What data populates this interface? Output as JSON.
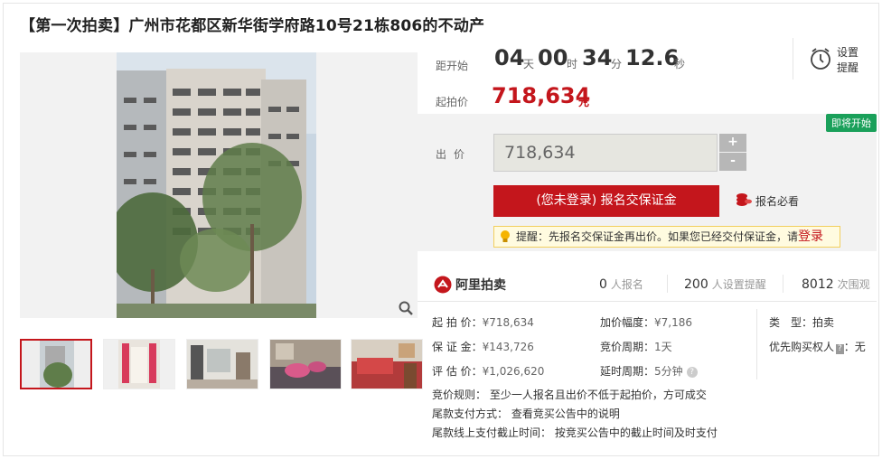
{
  "title": "【第一次拍卖】广州市花都区新华街学府路10号21栋806的不动产",
  "countdown": {
    "label": "距开始",
    "days": "04",
    "days_unit": "天",
    "hours": "00",
    "hours_unit": "时",
    "minutes": "34",
    "minutes_unit": "分",
    "seconds": "12.6",
    "seconds_unit": "秒"
  },
  "remind": {
    "line1": "设置",
    "line2": "提醒",
    "icon": "alarm-clock-icon"
  },
  "start_price": {
    "label": "起拍价",
    "value": "718,634",
    "unit": "元"
  },
  "badge": "即将开始",
  "bid": {
    "label": "出价",
    "value": "718,634",
    "plus": "+",
    "minus": "-",
    "signup_button": "(您未登录) 报名交保证金",
    "must_read": "报名必看",
    "notice_text": "提醒：先报名交保证金再出价。如果您已经交付保证金，请",
    "notice_link": "登录"
  },
  "stats": {
    "logo": "阿里拍卖",
    "signups": "0",
    "signups_unit": "人报名",
    "reminders": "200",
    "reminders_unit": "人设置提醒",
    "views": "8012",
    "views_unit": "次围观"
  },
  "details": {
    "start_price_k": "起 拍 价：",
    "start_price_v": "¥718,634",
    "deposit_k": "保 证 金：",
    "deposit_v": "¥143,726",
    "appraisal_k": "评 估 价：",
    "appraisal_v": "¥1,026,620",
    "increment_k": "加价幅度：",
    "increment_v": "¥7,186",
    "cycle_k": "竞价周期：",
    "cycle_v": "1天",
    "delay_k": "延时周期：",
    "delay_v": "5分钟",
    "type_k": "类　型：",
    "type_v": "拍卖",
    "priority_k": "优先购买权人",
    "priority_tag": "?",
    "priority_v": "：无"
  },
  "rules": {
    "rule1_k": "竞价规则：",
    "rule1_v": "至少一人报名且出价不低于起拍价，方可成交",
    "rule2_k": "尾款支付方式：",
    "rule2_v": "查看竞买公告中的说明",
    "rule3_k": "尾款线上支付截止时间：",
    "rule3_v": "按竞买公告中的截止时间及时支付"
  },
  "colors": {
    "accent": "#c4161c",
    "badge": "#1aa05a",
    "panel_bg": "#f2f2f2"
  }
}
